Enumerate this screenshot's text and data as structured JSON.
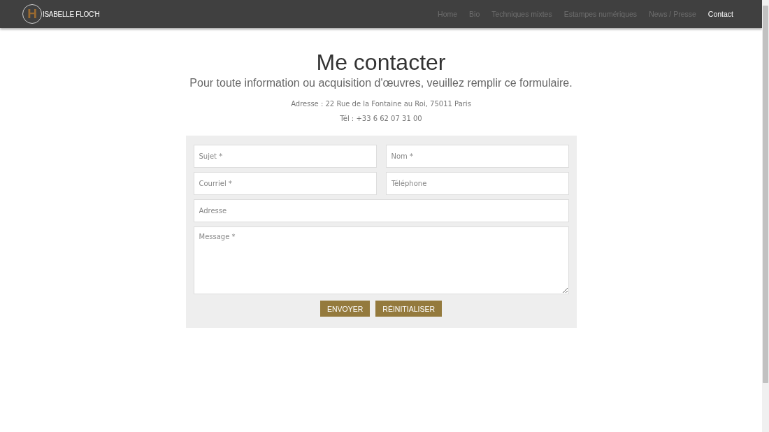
{
  "header": {
    "logo_monogram": "H",
    "site_name": "ISABELLE FLOC'H",
    "nav": [
      {
        "label": "Home",
        "selected": false
      },
      {
        "label": "Bio",
        "selected": false
      },
      {
        "label": "Techniques mixtes",
        "selected": false
      },
      {
        "label": "Estampes numériques",
        "selected": false
      },
      {
        "label": "News / Presse",
        "selected": false
      },
      {
        "label": "Contact",
        "selected": true
      }
    ]
  },
  "title": "Me contacter",
  "subtitle": "Pour toute information ou acquisition d'œuvres, veuillez remplir ce formulaire.",
  "address": "Adresse : 22 Rue de la Fontaine au Roi, 75011 Paris",
  "phone": "Tél : +33 6 62 07 31 00",
  "form": {
    "fields": [
      {
        "kind": "input",
        "wide": false,
        "placeholder": "Sujet *"
      },
      {
        "kind": "input",
        "wide": false,
        "placeholder": "Nom *"
      },
      {
        "kind": "input",
        "wide": false,
        "placeholder": "Courriel *"
      },
      {
        "kind": "input",
        "wide": false,
        "placeholder": "Téléphone"
      },
      {
        "kind": "input",
        "wide": true,
        "placeholder": "Adresse"
      },
      {
        "kind": "textarea",
        "wide": true,
        "placeholder": "Message *"
      }
    ],
    "buttons": [
      "ENVOYER",
      "RÉINITIALISER"
    ]
  }
}
